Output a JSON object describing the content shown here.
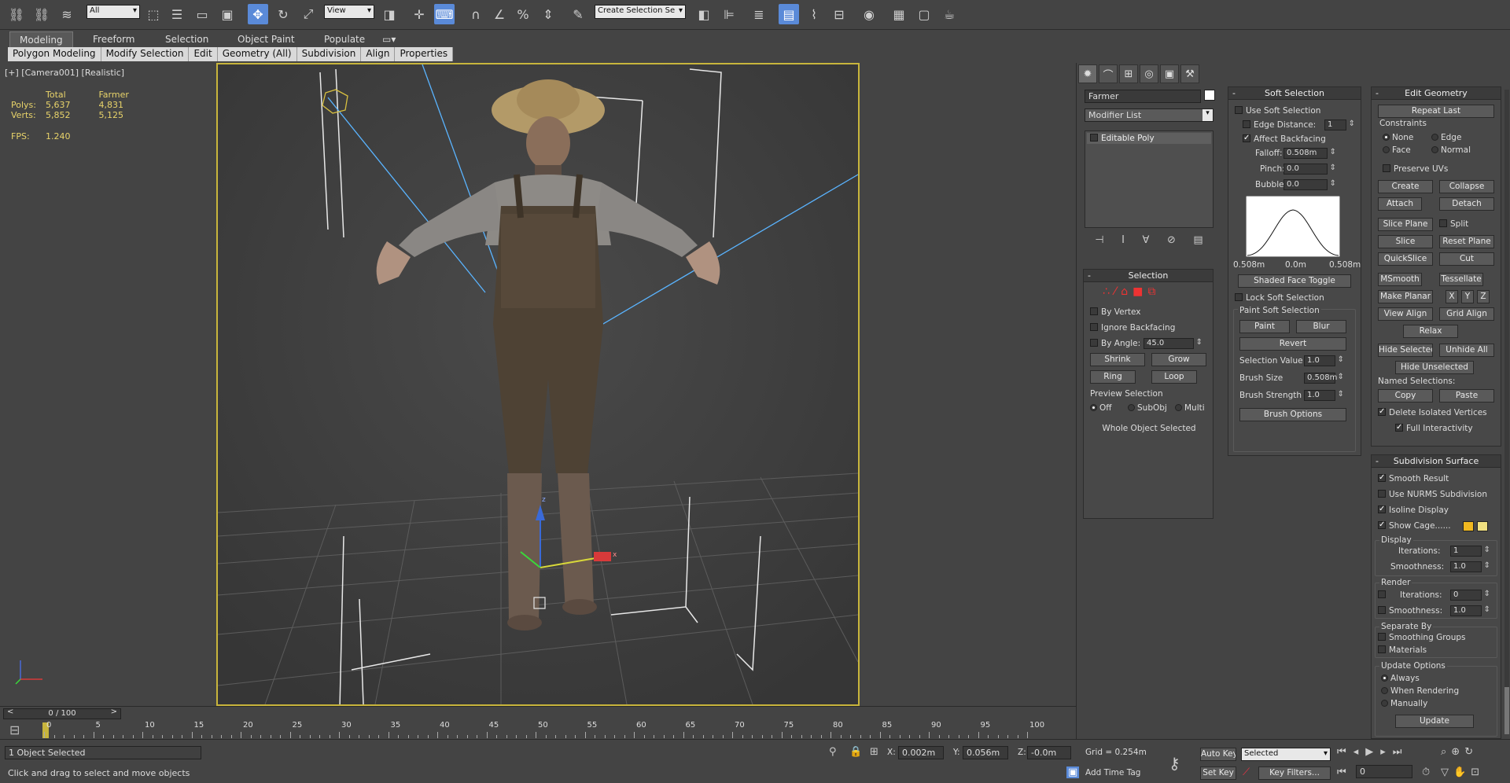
{
  "toolbar": {
    "selection_filter": "All",
    "ref_coord": "View",
    "named_selection_placeholder": "Create Selection Se"
  },
  "ribbon": {
    "tabs": [
      "Modeling",
      "Freeform",
      "Selection",
      "Object Paint",
      "Populate"
    ],
    "subtabs": [
      "Polygon Modeling",
      "Modify Selection",
      "Edit",
      "Geometry (All)",
      "Subdivision",
      "Align",
      "Properties"
    ]
  },
  "viewport": {
    "label": "[+] [Camera001] [Realistic]",
    "stats": {
      "col_total": "Total",
      "col_object": "Farmer",
      "polys_label": "Polys:",
      "polys_total": "5,637",
      "polys_object": "4,831",
      "verts_label": "Verts:",
      "verts_total": "5,852",
      "verts_object": "5,125",
      "fps_label": "FPS:",
      "fps_value": "1.240"
    },
    "gizmo_labels": {
      "z": "z",
      "x": "x"
    }
  },
  "command_panel": {
    "object_name": "Farmer",
    "modifier_list": "Modifier List",
    "stack_item": "Editable Poly",
    "selection": {
      "title": "Selection",
      "by_vertex": "By Vertex",
      "ignore_backfacing": "Ignore Backfacing",
      "by_angle": "By Angle:",
      "by_angle_value": "45.0",
      "shrink": "Shrink",
      "grow": "Grow",
      "ring": "Ring",
      "loop": "Loop",
      "preview": "Preview Selection",
      "off": "Off",
      "subobj": "SubObj",
      "multi": "Multi",
      "status": "Whole Object Selected"
    },
    "soft_selection": {
      "title": "Soft Selection",
      "use_soft": "Use Soft Selection",
      "edge_distance": "Edge Distance:",
      "edge_distance_value": "1",
      "affect_backfacing": "Affect Backfacing",
      "falloff": "Falloff:",
      "falloff_value": "0.508m",
      "pinch": "Pinch:",
      "pinch_value": "0.0",
      "bubble": "Bubble:",
      "bubble_value": "0.0",
      "curve_left": "0.508m",
      "curve_mid": "0.0m",
      "curve_right": "0.508m",
      "shaded_face_toggle": "Shaded Face Toggle",
      "lock_soft": "Lock Soft Selection",
      "paint_group": "Paint Soft Selection",
      "paint": "Paint",
      "blur": "Blur",
      "revert": "Revert",
      "selection_value": "Selection Value",
      "selection_value_v": "1.0",
      "brush_size": "Brush Size",
      "brush_size_v": "0.508m",
      "brush_strength": "Brush Strength",
      "brush_strength_v": "1.0",
      "brush_options": "Brush Options"
    },
    "edit_geometry": {
      "title": "Edit Geometry",
      "repeat_last": "Repeat Last",
      "constraints": "Constraints",
      "none": "None",
      "edge": "Edge",
      "face": "Face",
      "normal": "Normal",
      "preserve_uvs": "Preserve UVs",
      "create": "Create",
      "collapse": "Collapse",
      "attach": "Attach",
      "detach": "Detach",
      "slice_plane": "Slice Plane",
      "split": "Split",
      "slice": "Slice",
      "reset_plane": "Reset Plane",
      "quickslice": "QuickSlice",
      "cut": "Cut",
      "msmooth": "MSmooth",
      "tessellate": "Tessellate",
      "make_planar": "Make Planar",
      "x": "X",
      "y": "Y",
      "z": "Z",
      "view_align": "View Align",
      "grid_align": "Grid Align",
      "relax": "Relax",
      "hide_selected": "Hide Selected",
      "unhide_all": "Unhide All",
      "hide_unselected": "Hide Unselected",
      "named_selections": "Named Selections:",
      "copy": "Copy",
      "paste": "Paste",
      "delete_isolated": "Delete Isolated Vertices",
      "full_interactivity": "Full Interactivity"
    },
    "subdivision": {
      "title": "Subdivision Surface",
      "smooth_result": "Smooth Result",
      "use_nurms": "Use NURMS Subdivision",
      "isoline": "Isoline Display",
      "show_cage": "Show Cage......",
      "display": "Display",
      "iterations": "Iterations:",
      "iterations_v": "1",
      "smoothness": "Smoothness:",
      "smoothness_v": "1.0",
      "render": "Render",
      "r_iterations_v": "0",
      "r_smoothness_v": "1.0",
      "separate_by": "Separate By",
      "smoothing_groups": "Smoothing Groups",
      "materials": "Materials",
      "update_options": "Update Options",
      "always": "Always",
      "when_rendering": "When Rendering",
      "manually": "Manually",
      "update": "Update",
      "cage_color_1": "#f0b820",
      "cage_color_2": "#f0e080"
    }
  },
  "timeline": {
    "frame": "0 / 100",
    "ticks": [
      "0",
      "5",
      "10",
      "15",
      "20",
      "25",
      "30",
      "35",
      "40",
      "45",
      "50",
      "55",
      "60",
      "65",
      "70",
      "75",
      "80",
      "85",
      "90",
      "95",
      "100"
    ]
  },
  "status": {
    "selected": "1 Object Selected",
    "prompt": "Click and drag to select and move objects",
    "x_label": "X:",
    "x_value": "0.002m",
    "y_label": "Y:",
    "y_value": "0.056m",
    "z_label": "Z:",
    "z_value": "-0.0m",
    "grid": "Grid = 0.254m",
    "add_time_tag": "Add Time Tag",
    "auto_key": "Auto Key",
    "set_key": "Set Key",
    "key_mode": "Selected",
    "key_filters": "Key Filters...",
    "current_frame": "0"
  },
  "colors": {
    "viewport_border": "#c8b53c",
    "stats_text": "#e8d36a",
    "active_tool": "#5a8ad8"
  }
}
